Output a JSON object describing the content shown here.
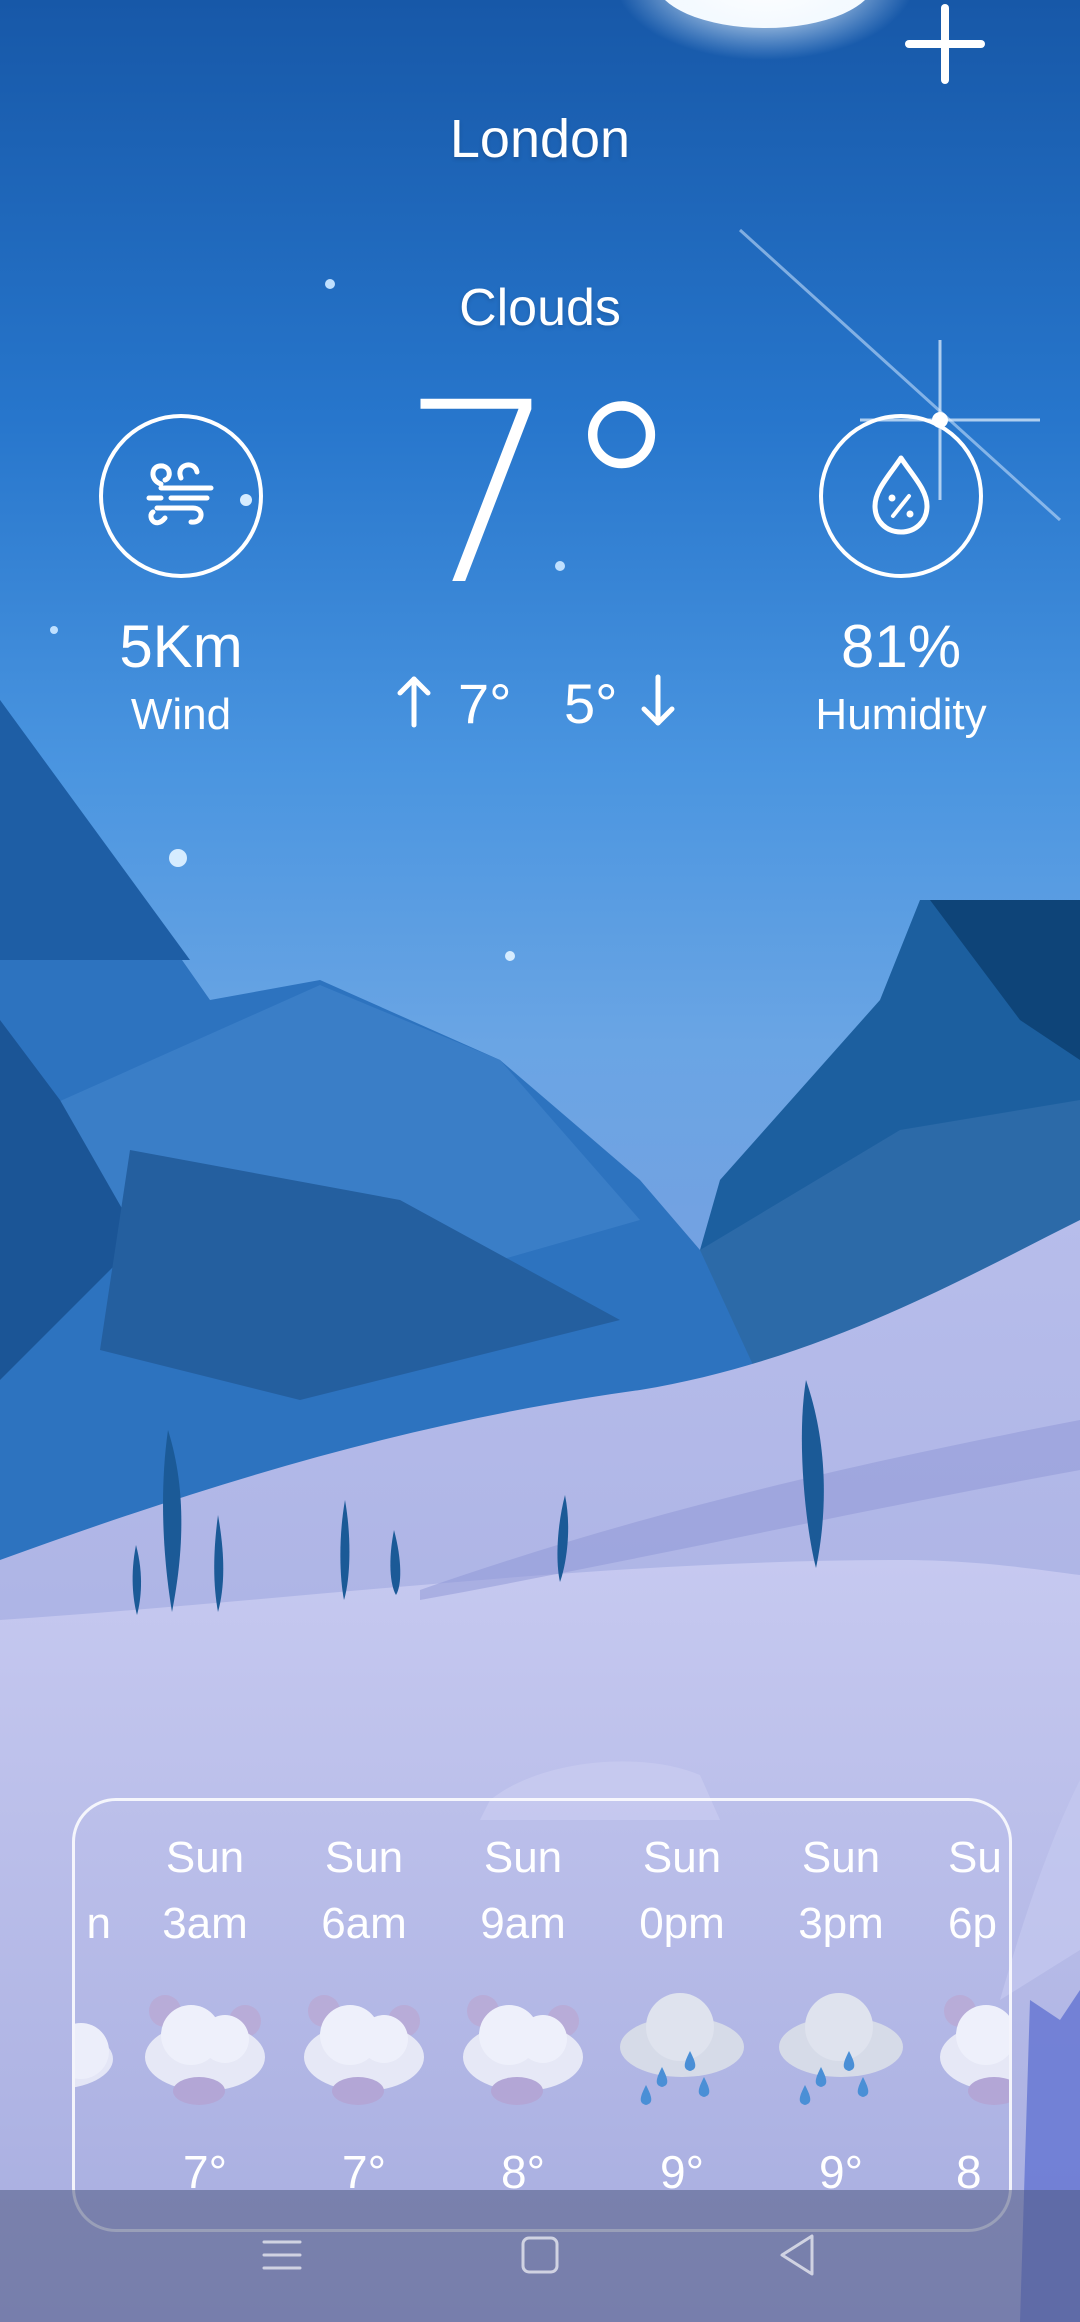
{
  "header": {
    "add_label": "+"
  },
  "city": "London",
  "condition": "Clouds",
  "temperature": "7°",
  "high": "7°",
  "low": "5°",
  "wind": {
    "value": "5Km",
    "label": "Wind",
    "icon": "wind-icon"
  },
  "humidity": {
    "value": "81%",
    "label": "Humidity",
    "icon": "humidity-icon"
  },
  "forecast": [
    {
      "day": "",
      "time": "n",
      "icon": "cloud-icon",
      "temp": ""
    },
    {
      "day": "Sun",
      "time": "3am",
      "icon": "cloudy-icon",
      "temp": "7°"
    },
    {
      "day": "Sun",
      "time": "6am",
      "icon": "cloudy-icon",
      "temp": "7°"
    },
    {
      "day": "Sun",
      "time": "9am",
      "icon": "cloudy-icon",
      "temp": "8°"
    },
    {
      "day": "Sun",
      "time": "0pm",
      "icon": "rain-icon",
      "temp": "9°"
    },
    {
      "day": "Sun",
      "time": "3pm",
      "icon": "rain-icon",
      "temp": "9°"
    },
    {
      "day": "Su",
      "time": "6p",
      "icon": "cloudy-icon",
      "temp": "8"
    }
  ],
  "navbar": {
    "menu_icon": "menu-icon",
    "home_icon": "home-icon",
    "back_icon": "back-icon"
  },
  "colors": {
    "sky_top": "#1a5fae",
    "sky_mid": "#3d8ee0",
    "snow": "#aeb3e6",
    "mountain": "#2a6aaa"
  }
}
